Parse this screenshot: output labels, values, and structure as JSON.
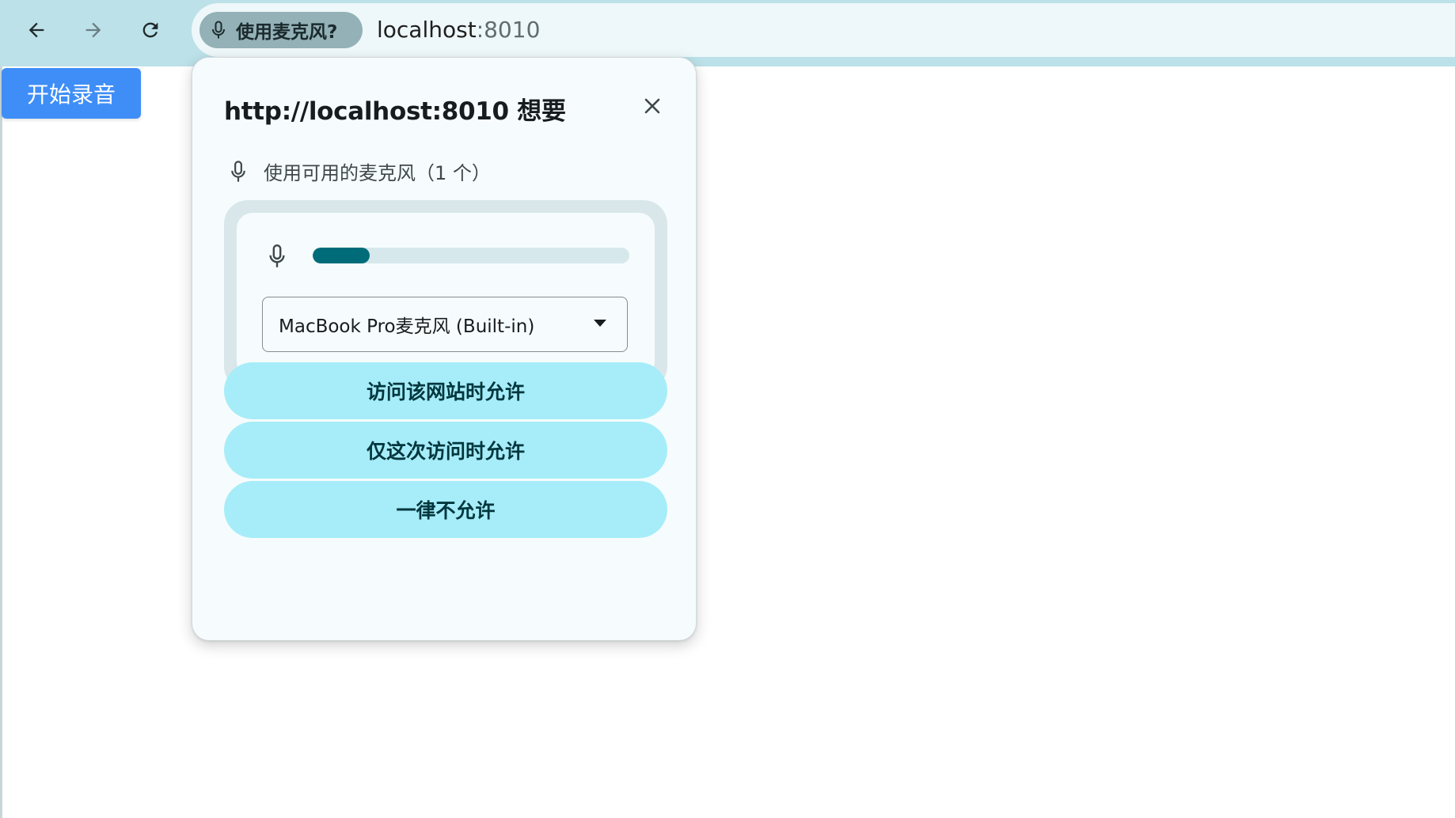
{
  "browser": {
    "nav": {
      "back_icon": "arrow-left-icon",
      "forward_icon": "arrow-right-icon",
      "reload_icon": "reload-icon"
    },
    "mic_chip_label": "使用麦克风?",
    "url_host": "localhost",
    "url_port": ":8010"
  },
  "page": {
    "start_button_label": "开始录音",
    "start_button_color": "#3f8ef7"
  },
  "popup": {
    "title": "http://localhost:8010 想要",
    "permission_text": "使用可用的麦克风（1 个）",
    "mic_level": 0.18,
    "device_select_value": "MacBook Pro麦克风 (Built-in)",
    "buttons": [
      "访问该网站时允许",
      "仅这次访问时允许",
      "一律不允许"
    ],
    "colors": {
      "button_bg": "#a6edf9",
      "level_fill": "#006c7a",
      "background": "#f6fcfd"
    }
  }
}
